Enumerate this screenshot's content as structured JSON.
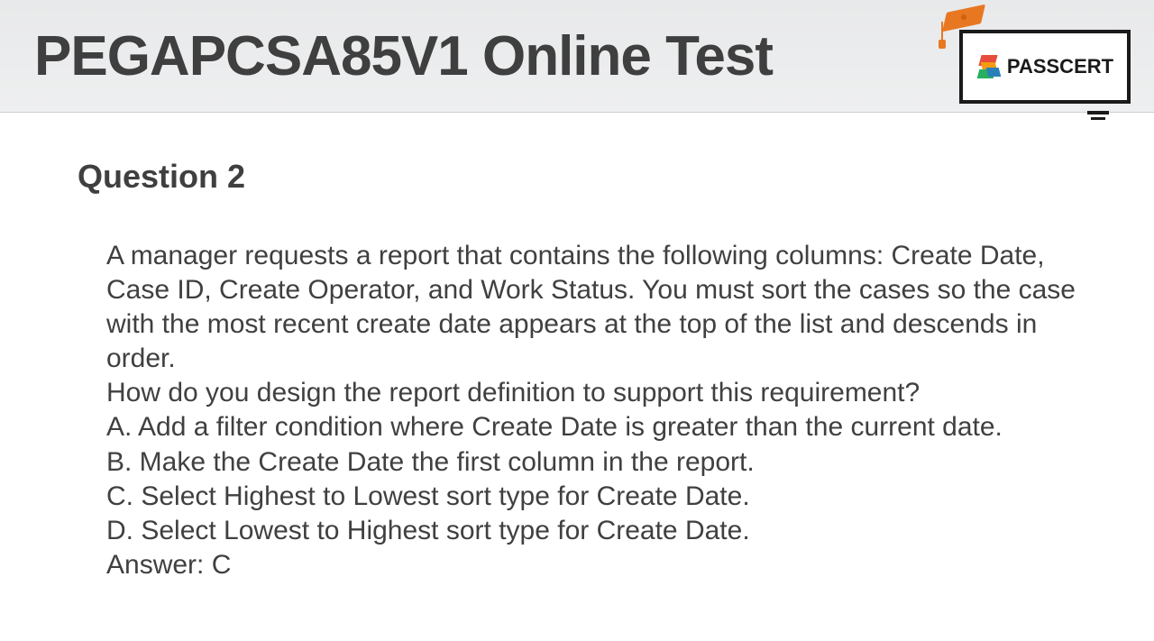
{
  "header": {
    "title": "PEGAPCSA85V1 Online Test",
    "logo_text": "PASSCERT"
  },
  "question": {
    "number": "Question 2",
    "scenario": "A manager requests a report that contains the following columns: Create Date, Case ID, Create Operator, and Work Status. You must sort the cases so the case with the most recent create date appears at the top of the list and descends in order.",
    "prompt": "How do you design the report definition to support this requirement?",
    "options": {
      "a": "A. Add a filter condition where Create Date is greater than the current date.",
      "b": "B. Make the Create Date the first column in the report.",
      "c": "C. Select Highest to Lowest sort type for Create Date.",
      "d": "D. Select Lowest to Highest sort type for Create Date."
    },
    "answer": "Answer: C"
  }
}
